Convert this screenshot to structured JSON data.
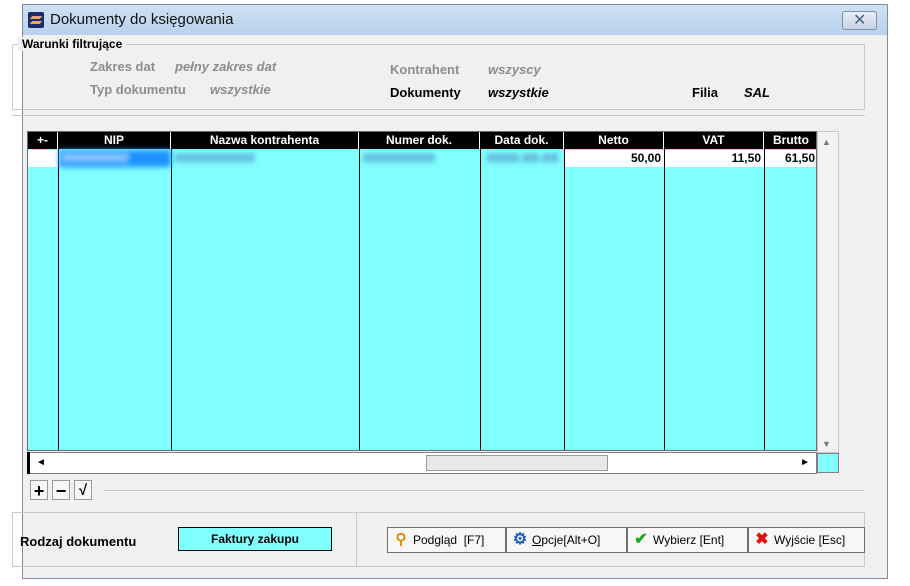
{
  "window": {
    "title": "Dokumenty do księgowania",
    "close_symbol": "✕"
  },
  "filters": {
    "group_title": "Warunki filtrujące",
    "zakres_dat": {
      "label": "Zakres dat",
      "value": "pełny zakres dat"
    },
    "typ_dokumentu": {
      "label": "Typ dokumentu",
      "value": "wszystkie"
    },
    "kontrahent": {
      "label": "Kontrahent",
      "value": "wszyscy"
    },
    "dokumenty": {
      "label": "Dokumenty",
      "value": "wszystkie"
    },
    "filia": {
      "label": "Filia",
      "value": "SAL"
    }
  },
  "table": {
    "columns": [
      "+-",
      "NIP",
      "Nazwa kontrahenta",
      "Numer dok.",
      "Data dok.",
      "Netto",
      "VAT",
      "Brutto"
    ],
    "rows": [
      {
        "mark": "",
        "nip": "0000000000",
        "nazwa": "XXXXXXXXXX",
        "numer": "XXXXXXXXX",
        "data": "XXXX-XX-XX",
        "netto": "50,00",
        "vat": "11,50",
        "brutto": "61,50"
      }
    ]
  },
  "toolbar": {
    "add": "+",
    "remove": "−",
    "confirm": "√"
  },
  "bottom": {
    "rodzaj_label": "Rodzaj dokumentu",
    "rodzaj_value": "Faktury zakupu",
    "podglad": {
      "label": "Podgląd",
      "key": "[F7]"
    },
    "opcje": {
      "label_u": "O",
      "label_rest": "pcje[Alt+O]"
    },
    "wybierz": {
      "label": "Wybierz",
      "key": "[Ent]"
    },
    "wyjscie": {
      "label": "Wyjście",
      "key": "[Esc]"
    }
  },
  "colors": {
    "grid_bg": "#80ffff",
    "header_bg": "#000000",
    "selection": "#1e90ff"
  },
  "icons": [
    "app-icon",
    "close-icon",
    "search-icon",
    "gear-icon",
    "checkmark-icon",
    "x-icon"
  ]
}
